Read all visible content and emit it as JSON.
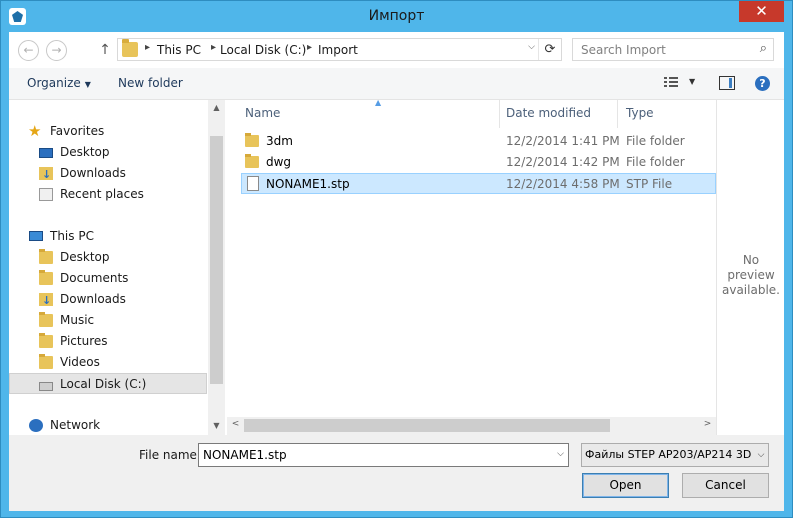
{
  "window": {
    "title": "Импорт",
    "close_symbol": "✕"
  },
  "address": {
    "back_symbol": "←",
    "forward_symbol": "→",
    "up_symbol": "↑",
    "crumbs": [
      "This PC",
      "Local Disk (C:)",
      "Import"
    ],
    "separator": "▸",
    "dropdown_symbol": "⌵",
    "refresh_symbol": "⟳"
  },
  "search": {
    "placeholder": "Search Import",
    "icon_symbol": "⌕"
  },
  "toolbar": {
    "organize_label": "Organize",
    "organize_caret": "▼",
    "new_folder_label": "New folder",
    "view_caret": "▼",
    "help_symbol": "?"
  },
  "nav": {
    "items": [
      {
        "label": "Favorites",
        "icon": "star-icon"
      },
      {
        "label": "Desktop",
        "icon": "desktop-icon"
      },
      {
        "label": "Downloads",
        "icon": "downloads-icon"
      },
      {
        "label": "Recent places",
        "icon": "recent-places-icon"
      },
      {
        "label": "This PC",
        "icon": "computer-icon"
      },
      {
        "label": "Desktop",
        "icon": "desktop-folder-icon"
      },
      {
        "label": "Documents",
        "icon": "documents-icon"
      },
      {
        "label": "Downloads",
        "icon": "downloads-icon"
      },
      {
        "label": "Music",
        "icon": "music-icon"
      },
      {
        "label": "Pictures",
        "icon": "pictures-icon"
      },
      {
        "label": "Videos",
        "icon": "videos-icon"
      },
      {
        "label": "Local Disk (C:)",
        "icon": "local-disk-icon"
      },
      {
        "label": "Network",
        "icon": "network-icon"
      }
    ],
    "selected": "Local Disk (C:)",
    "scroll_up": "▲",
    "scroll_down": "▼"
  },
  "filelist": {
    "columns": [
      "Name",
      "Date modified",
      "Type"
    ],
    "sort_arrow": "▲",
    "rows": [
      {
        "name": "3dm",
        "date": "12/2/2014 1:41 PM",
        "type": "File folder",
        "icon": "folder-icon"
      },
      {
        "name": "dwg",
        "date": "12/2/2014 1:42 PM",
        "type": "File folder",
        "icon": "folder-icon"
      },
      {
        "name": "NONAME1.stp",
        "date": "12/2/2014 4:58 PM",
        "type": "STP File",
        "icon": "document-icon",
        "selected": true
      }
    ],
    "hscroll_left": "<",
    "hscroll_right": ">"
  },
  "preview": {
    "line1": "No preview",
    "line2": "available."
  },
  "bottom": {
    "file_name_label": "File name:",
    "file_name_value": "NONAME1.stp",
    "file_name_drop": "⌵",
    "file_type_value": "Файлы STEP AP203/AP214 3D (",
    "file_type_drop": "⌵",
    "open_label": "Open",
    "cancel_label": "Cancel"
  },
  "colors": {
    "frame": "#4fb6ea",
    "close": "#c7392b",
    "selection": "#cce8ff"
  }
}
